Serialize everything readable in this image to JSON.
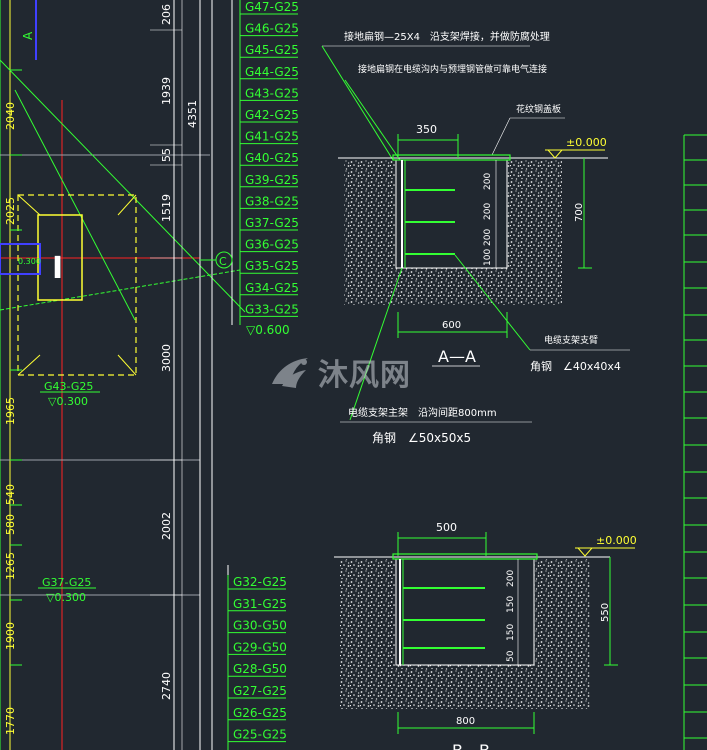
{
  "colors": {
    "background": "#212830",
    "green": "#33ff33",
    "lime": "#40f040",
    "white": "#ffffff",
    "yellow": "#ffff33",
    "red": "#ff2222",
    "blue": "#4040ff",
    "gray": "#9aa1a8"
  },
  "grid": {
    "axis_a": "A",
    "axis_c": "C"
  },
  "bars_top": [
    "G47-G25",
    "G46-G25",
    "G45-G25",
    "G44-G25",
    "G43-G25",
    "G42-G25",
    "G41-G25",
    "G40-G25",
    "G39-G25",
    "G38-G25",
    "G37-G25",
    "G36-G25",
    "G35-G25",
    "G34-G25",
    "G33-G25"
  ],
  "bars_top_level": "▽0.600",
  "bars_bottom": [
    "G32-G25",
    "G31-G25",
    "G30-G50",
    "G29-G50",
    "G28-G50",
    "G27-G25",
    "G26-G25",
    "G25-G25"
  ],
  "left_dims": [
    "2040",
    "2025",
    "1965",
    "540",
    "580",
    "1265",
    "1900",
    "1770"
  ],
  "left_labels": {
    "g43": "G43-G25",
    "g43_level": "▽0.300",
    "g37": "G37-G25",
    "g37_level": "▽0.300",
    "small_level": "0.300"
  },
  "column_dims": [
    "206",
    "1939",
    "55",
    "1519",
    "3000",
    "2002",
    "2740"
  ],
  "total_dim": "4351",
  "notes": {
    "note1": "接地扁钢—25X4　沿支架焊接，并做防腐处理",
    "note2": "接地扁钢在电缆沟内与预埋钢管做可靠电气连接",
    "cover_plate": "花纹钢盖板",
    "support_bracket": "电缆支架支臂",
    "support_bracket_angle": "角钢　∠40x40x4",
    "main_support": "电缆支架主架　沿沟间距800mm",
    "main_support_angle": "角钢　∠50x50x5"
  },
  "section_aa": {
    "title": "A—A",
    "top_width": "350",
    "elevation": "±0.000",
    "bottom_width": "600",
    "depth": "700",
    "spacings": [
      "200",
      "200",
      "200",
      "100"
    ]
  },
  "section_bb": {
    "title": "B—B",
    "top_width": "500",
    "elevation": "±0.000",
    "bottom_width": "800",
    "depth": "550",
    "spacings": [
      "200",
      "150",
      "150",
      "50"
    ]
  },
  "watermark": "沐风网"
}
